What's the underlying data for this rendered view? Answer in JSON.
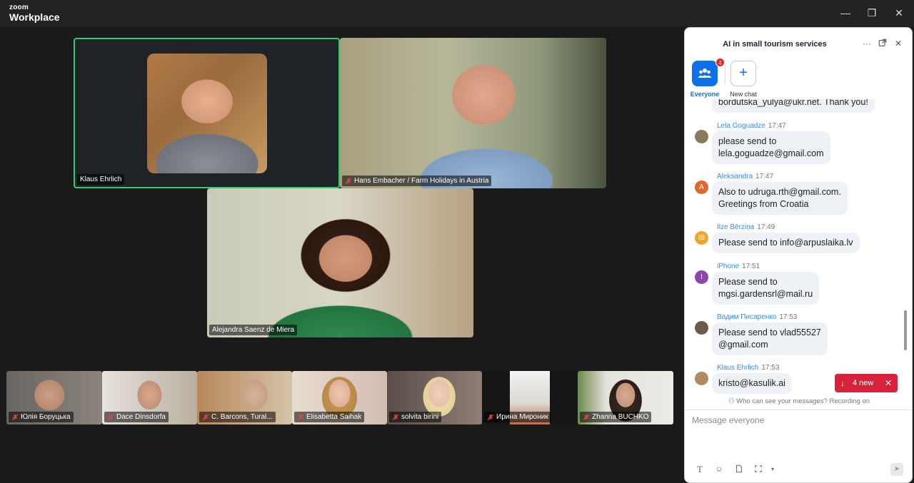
{
  "app": {
    "brand_small": "zoom",
    "brand_large": "Workplace"
  },
  "window_controls": {
    "minimize": "—",
    "restore": "❐",
    "close": "✕"
  },
  "participants": {
    "featured": [
      {
        "name": "Klaus Ehrlich",
        "muted": false,
        "active_speaker": true
      },
      {
        "name": "Hans Embacher / Farm Holidays in Austria",
        "muted": true
      },
      {
        "name": "Alejandra Saenz de Miera",
        "muted": false
      }
    ],
    "strip": [
      {
        "name": "Юлія Боруцька",
        "muted": true
      },
      {
        "name": "Dace Dinsdorfa",
        "muted": true
      },
      {
        "name": "C. Barcons, Tural...",
        "muted": true
      },
      {
        "name": "Elisabetta Saihak",
        "muted": true
      },
      {
        "name": "solvita birini",
        "muted": true
      },
      {
        "name": "Ирина Мироник",
        "muted": true
      },
      {
        "name": "Zhanna BUCHKO",
        "muted": true
      }
    ]
  },
  "chat": {
    "title": "AI in small tourism services",
    "tabs": {
      "everyone_label": "Everyone",
      "everyone_badge": "4",
      "new_chat_label": "New chat"
    },
    "partial_message": "bordutska_yulya@ukr.net. Thank you!",
    "messages": [
      {
        "sender": "Lela Goguadze",
        "time": "17:47",
        "avatar": "",
        "avatar_color": "#8a7a5a",
        "lines": [
          "please send to",
          "lela.goguadze@gmail.com"
        ]
      },
      {
        "sender": "Aleksandra",
        "time": "17:47",
        "avatar": "A",
        "avatar_color": "#e0662a",
        "lines": [
          "Also to udruga.rth@gmail.com.",
          "Greetings from Croatia"
        ]
      },
      {
        "sender": "Ilze Bērziņa",
        "time": "17:49",
        "avatar": "IB",
        "avatar_color": "#f0a52a",
        "lines": [
          "Please send to info@arpuslaika.lv"
        ]
      },
      {
        "sender": "iPhone",
        "time": "17:51",
        "avatar": "I",
        "avatar_color": "#8e44ad",
        "lines": [
          "Please send to",
          "mgsi.gardensrl@mail.ru"
        ]
      },
      {
        "sender": "Вадим Писаренко",
        "time": "17:53",
        "avatar": "",
        "avatar_color": "#6b5a4a",
        "lines": [
          "Please send to vlad55527",
          "@gmail.com"
        ]
      },
      {
        "sender": "Klaus Ehrlich",
        "time": "17:53",
        "avatar": "",
        "avatar_color": "#b08a60",
        "lines": [
          "kristo@kasulik.ai"
        ]
      }
    ],
    "new_messages": {
      "label": "4 new"
    },
    "privacy_note": "Who can see your messages? Recording on",
    "compose_placeholder": "Message everyone"
  },
  "colors": {
    "accent": "#0e71eb",
    "active_speaker_border": "#2ecc71",
    "alert": "#d6223a"
  }
}
